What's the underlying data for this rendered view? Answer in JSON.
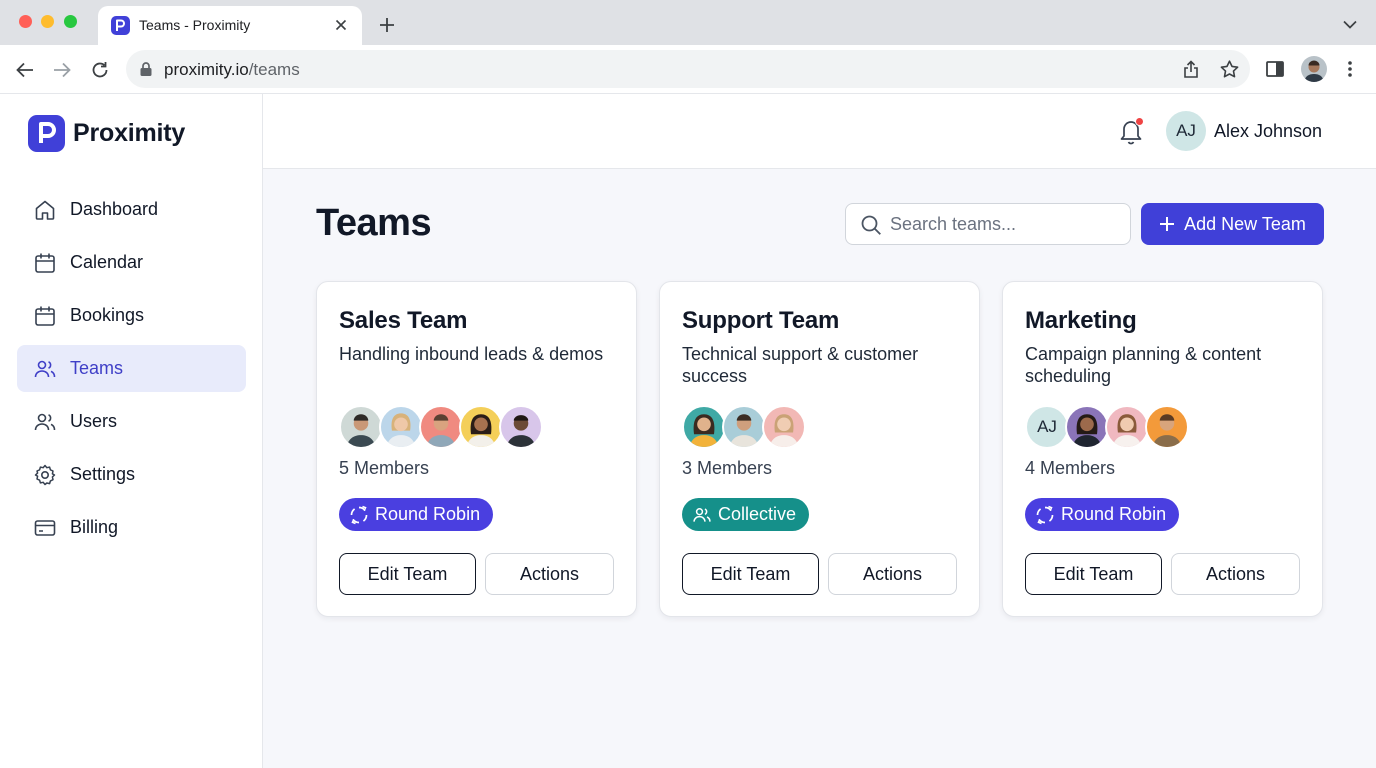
{
  "browser": {
    "tab_title": "Teams - Proximity",
    "url_domain": "proximity.io",
    "url_path": "/teams"
  },
  "brand": {
    "name": "Proximity",
    "logo_icon": "proximity-logo"
  },
  "sidebar": {
    "items": [
      {
        "label": "Dashboard",
        "icon": "home-icon",
        "active": false
      },
      {
        "label": "Calendar",
        "icon": "calendar-icon",
        "active": false
      },
      {
        "label": "Bookings",
        "icon": "calendar-icon",
        "active": false
      },
      {
        "label": "Teams",
        "icon": "users-icon",
        "active": true
      },
      {
        "label": "Users",
        "icon": "users-icon",
        "active": false
      },
      {
        "label": "Settings",
        "icon": "gear-icon",
        "active": false
      },
      {
        "label": "Billing",
        "icon": "credit-card-icon",
        "active": false
      }
    ]
  },
  "header": {
    "user_initials": "AJ",
    "user_name": "Alex Johnson",
    "has_notification": true
  },
  "main": {
    "title": "Teams",
    "search_placeholder": "Search teams...",
    "add_button_label": "Add New Team"
  },
  "teams": [
    {
      "name": "Sales Team",
      "description": "Handling inbound leads & demos",
      "members_label": "5 Members",
      "badge_label": "Round Robin",
      "badge_type": "round-robin",
      "edit_label": "Edit Team",
      "actions_label": "Actions",
      "avatars": [
        {
          "initials": "",
          "bg": "#cfd9d6"
        },
        {
          "initials": "",
          "bg": "#bcd6ea"
        },
        {
          "initials": "",
          "bg": "#f08a80"
        },
        {
          "initials": "",
          "bg": "#f4cf59"
        },
        {
          "initials": "",
          "bg": "#d8c6ea"
        }
      ]
    },
    {
      "name": "Support Team",
      "description": "Technical support & customer success",
      "members_label": "3 Members",
      "badge_label": "Collective",
      "badge_type": "collective",
      "edit_label": "Edit Team",
      "actions_label": "Actions",
      "avatars": [
        {
          "initials": "",
          "bg": "#3fa9a5"
        },
        {
          "initials": "",
          "bg": "#a9cdd8"
        },
        {
          "initials": "",
          "bg": "#f2b8b5"
        }
      ]
    },
    {
      "name": "Marketing",
      "description": "Campaign planning & content scheduling",
      "members_label": "4 Members",
      "badge_label": "Round Robin",
      "badge_type": "round-robin",
      "edit_label": "Edit Team",
      "actions_label": "Actions",
      "avatars": [
        {
          "initials": "AJ",
          "bg": "#cfe6e6"
        },
        {
          "initials": "",
          "bg": "#8a74b8"
        },
        {
          "initials": "",
          "bg": "#f0b8c0"
        },
        {
          "initials": "",
          "bg": "#f39a3a"
        }
      ]
    }
  ],
  "colors": {
    "accent": "#4040d8",
    "accent_active_bg": "#e8ebfb",
    "round_robin": "#4a3fe0",
    "collective": "#15908a",
    "notification_dot": "#ef4444"
  }
}
